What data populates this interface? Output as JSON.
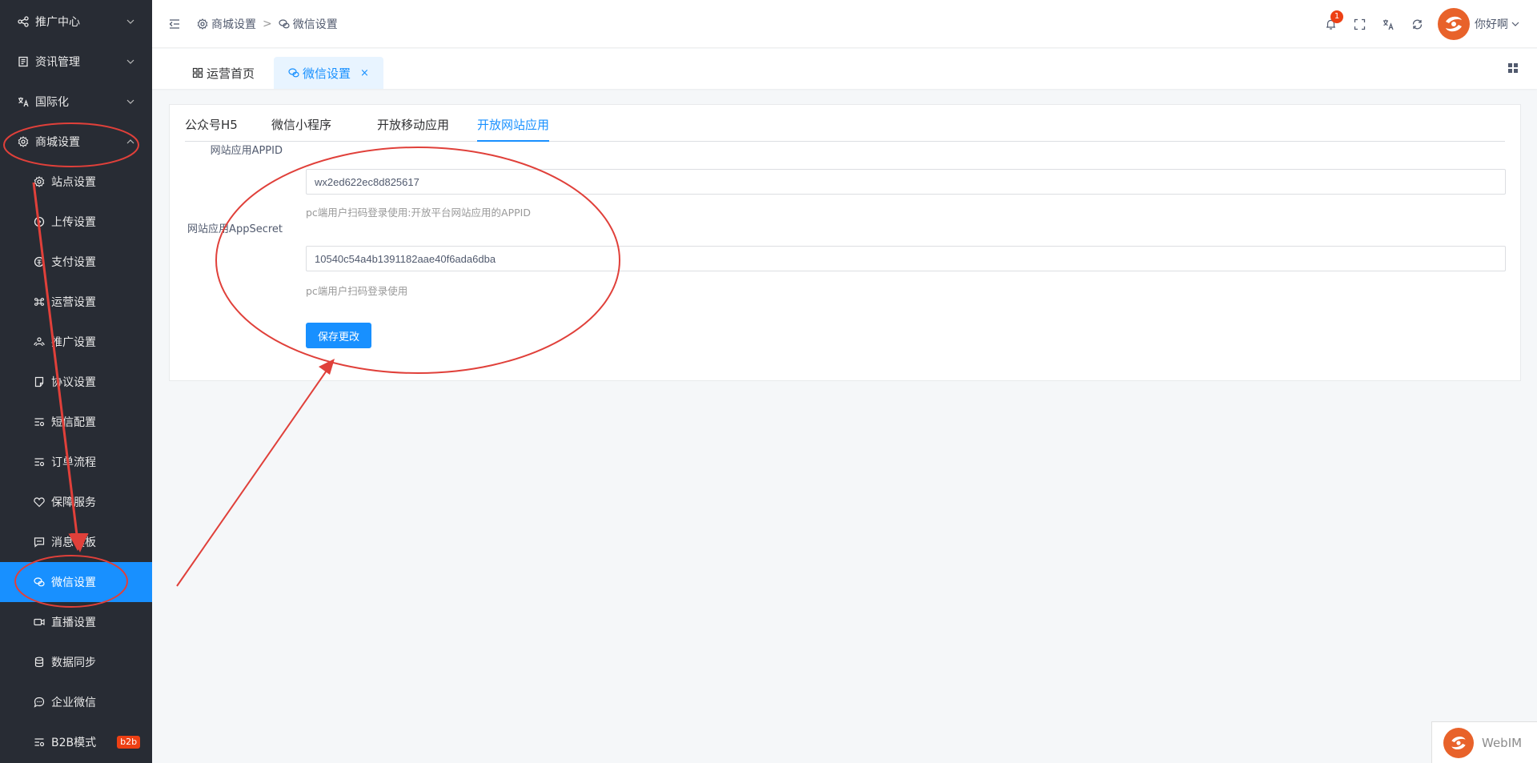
{
  "sidebar": {
    "items": [
      {
        "label": "推广中心",
        "icon": "share-icon",
        "type": "group"
      },
      {
        "label": "资讯管理",
        "icon": "news-icon",
        "type": "group"
      },
      {
        "label": "国际化",
        "icon": "translate-icon",
        "type": "group"
      },
      {
        "label": "商城设置",
        "icon": "gear-icon",
        "type": "group-open"
      },
      {
        "label": "站点设置",
        "icon": "gear-icon",
        "type": "sub"
      },
      {
        "label": "上传设置",
        "icon": "upload-icon",
        "type": "sub"
      },
      {
        "label": "支付设置",
        "icon": "payment-icon",
        "type": "sub"
      },
      {
        "label": "运营设置",
        "icon": "command-icon",
        "type": "sub"
      },
      {
        "label": "推广设置",
        "icon": "people-icon",
        "type": "sub"
      },
      {
        "label": "协议设置",
        "icon": "document-icon",
        "type": "sub"
      },
      {
        "label": "短信配置",
        "icon": "sms-config-icon",
        "type": "sub"
      },
      {
        "label": "订单流程",
        "icon": "order-flow-icon",
        "type": "sub"
      },
      {
        "label": "保障服务",
        "icon": "guarantee-icon",
        "type": "sub"
      },
      {
        "label": "消息模板",
        "icon": "message-icon",
        "type": "sub"
      },
      {
        "label": "微信设置",
        "icon": "wechat-icon",
        "type": "sub-active"
      },
      {
        "label": "直播设置",
        "icon": "video-icon",
        "type": "sub"
      },
      {
        "label": "数据同步",
        "icon": "database-icon",
        "type": "sub"
      },
      {
        "label": "企业微信",
        "icon": "chat-bubble-icon",
        "type": "sub"
      },
      {
        "label": "B2B模式",
        "icon": "b2b-icon",
        "type": "sub",
        "badge": "b2b"
      }
    ]
  },
  "header": {
    "breadcrumb": [
      {
        "label": "商城设置",
        "icon": "gear-icon"
      },
      {
        "label": "微信设置",
        "icon": "wechat-icon"
      }
    ],
    "breadcrumb_separator": ">",
    "notification_count": "1",
    "user_name": "你好啊"
  },
  "page_tabs": [
    {
      "label": "运营首页",
      "icon": "dashboard-icon",
      "active": false
    },
    {
      "label": "微信设置",
      "icon": "wechat-icon",
      "active": true,
      "close": "×"
    }
  ],
  "content": {
    "sub_tabs": [
      "公众号H5",
      "微信小程序",
      "开放移动应用",
      "开放网站应用"
    ],
    "active_sub_tab": "开放网站应用",
    "form": {
      "appid_label": "网站应用APPID",
      "appid_value": "wx2ed622ec8d825617",
      "appid_hint": "pc端用户扫码登录使用:开放平台网站应用的APPID",
      "secret_label": "网站应用AppSecret",
      "secret_value": "10540c54a4b1391182aae40f6ada6dba",
      "secret_hint": "pc端用户扫码登录使用",
      "save_label": "保存更改"
    }
  },
  "webim": {
    "label": "WebIM"
  },
  "colors": {
    "sidebar_bg": "#282c34",
    "accent": "#1890ff",
    "annotation_red": "#e0403a",
    "avatar_orange": "#e8622a"
  }
}
